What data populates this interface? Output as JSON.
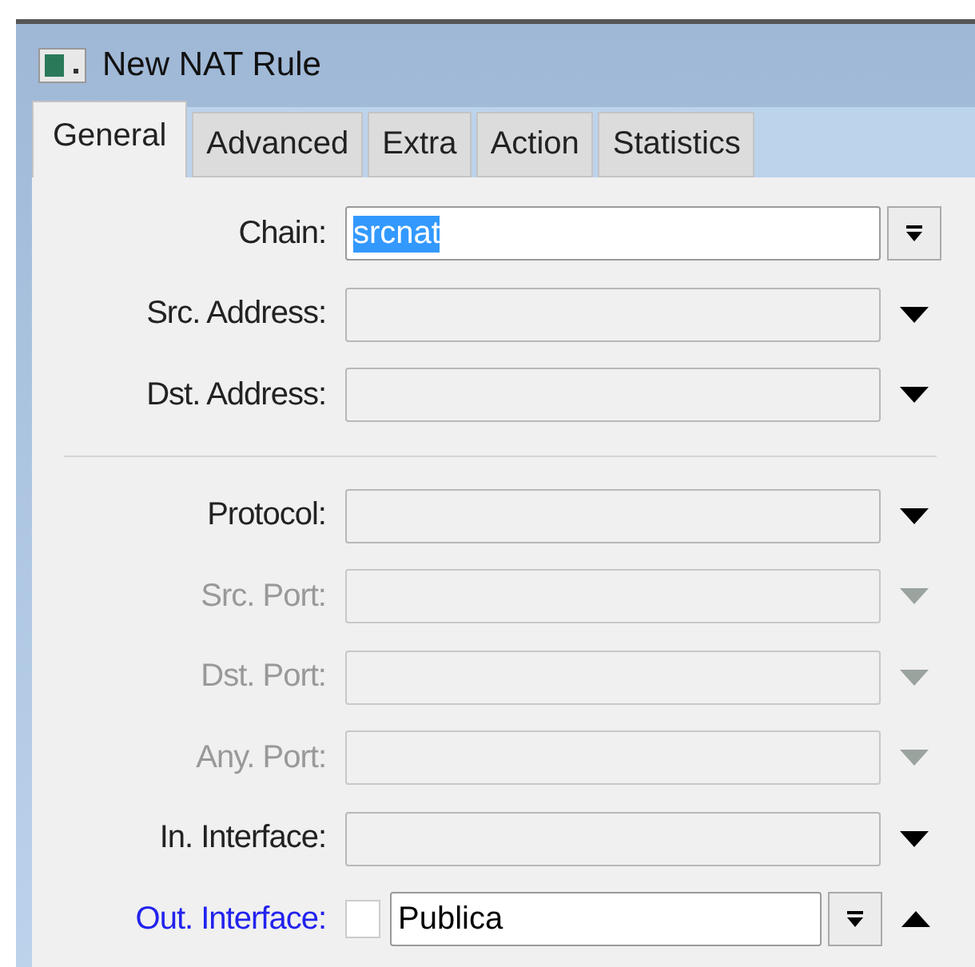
{
  "window": {
    "title": "New NAT Rule"
  },
  "tabs": [
    {
      "label": "General",
      "selected": true
    },
    {
      "label": "Advanced",
      "selected": false
    },
    {
      "label": "Extra",
      "selected": false
    },
    {
      "label": "Action",
      "selected": false
    },
    {
      "label": "Statistics",
      "selected": false
    }
  ],
  "groups": [
    [
      {
        "label": "Chain:",
        "kind": "combo",
        "value": "srcnat",
        "value_selected": true,
        "disabled": false,
        "highlighted": false
      },
      {
        "label": "Src. Address:",
        "kind": "select",
        "disabled": false,
        "highlighted": false,
        "expanded": false
      },
      {
        "label": "Dst. Address:",
        "kind": "select",
        "disabled": false,
        "highlighted": false,
        "expanded": false
      }
    ],
    [
      {
        "label": "Protocol:",
        "kind": "select",
        "disabled": false,
        "highlighted": false,
        "expanded": false
      },
      {
        "label": "Src. Port:",
        "kind": "select",
        "disabled": true,
        "highlighted": false,
        "expanded": false
      },
      {
        "label": "Dst. Port:",
        "kind": "select",
        "disabled": true,
        "highlighted": false,
        "expanded": false
      },
      {
        "label": "Any. Port:",
        "kind": "select",
        "disabled": true,
        "highlighted": false,
        "expanded": false
      },
      {
        "label": "In. Interface:",
        "kind": "select",
        "disabled": false,
        "highlighted": false,
        "expanded": false
      },
      {
        "label": "Out. Interface:",
        "kind": "negatable",
        "checked": false,
        "value": "Publica",
        "value_selected": false,
        "disabled": false,
        "highlighted": true,
        "expanded": true
      }
    ]
  ]
}
